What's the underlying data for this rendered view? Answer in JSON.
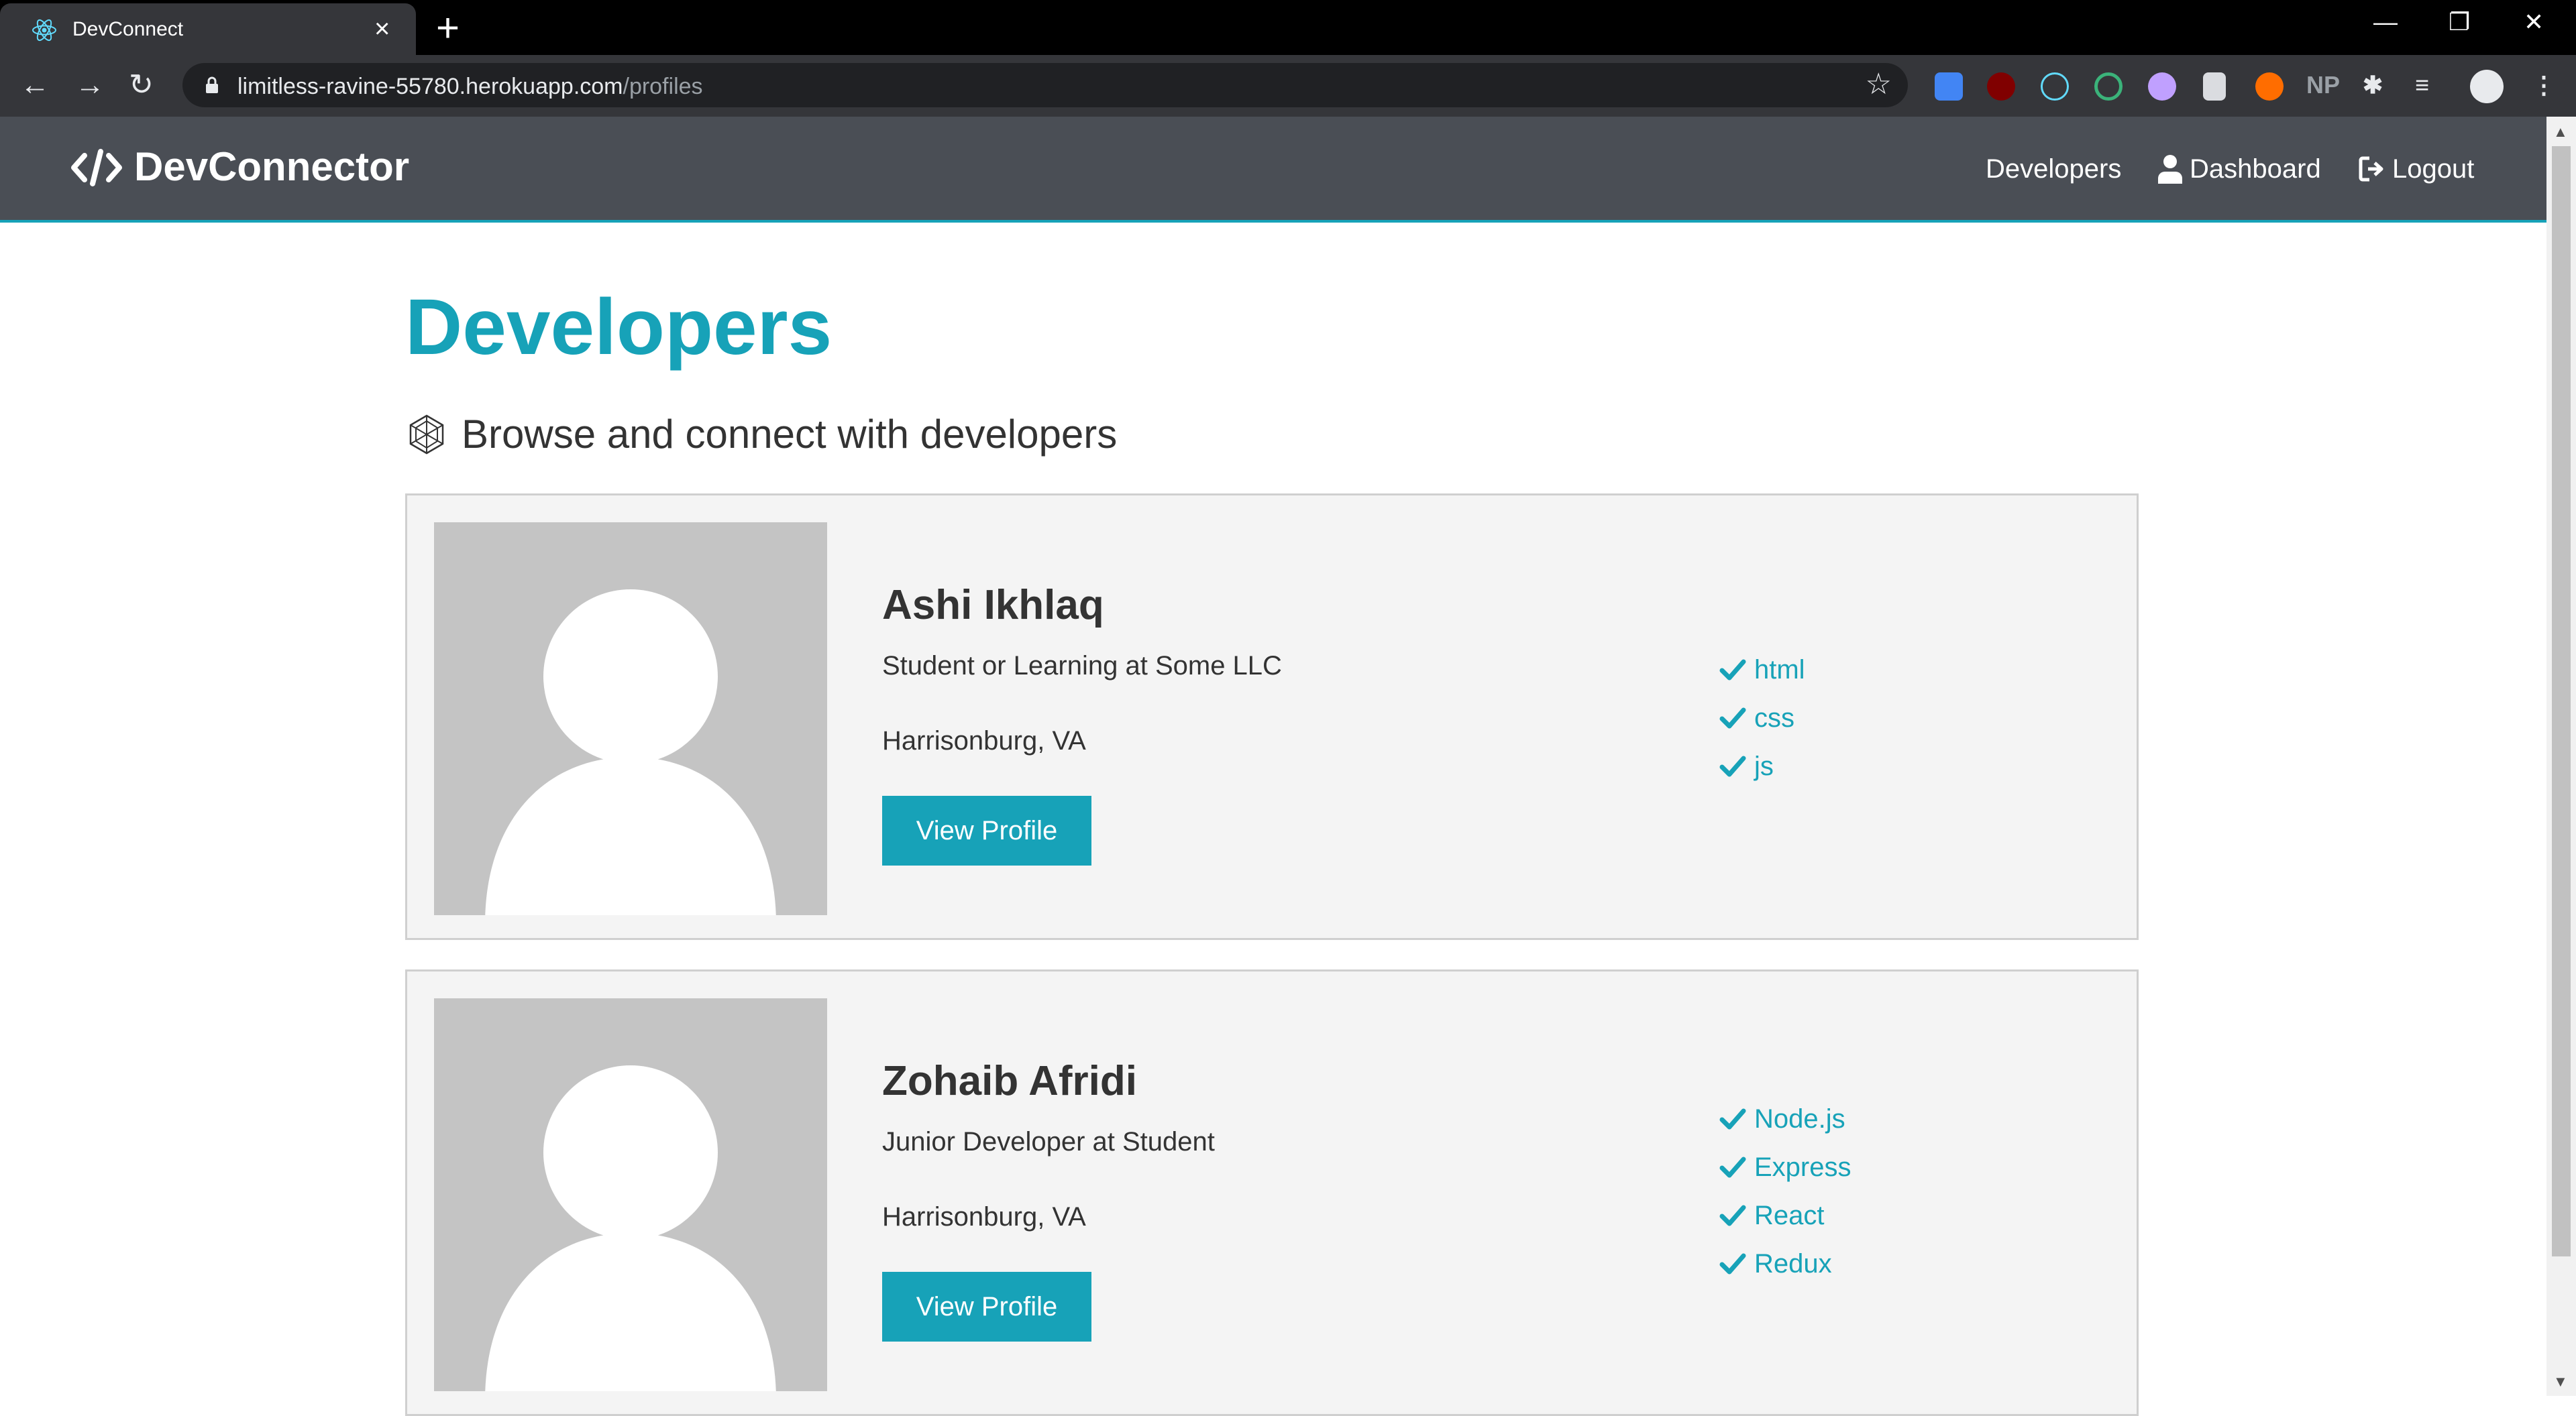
{
  "browser": {
    "tab_title": "DevConnect",
    "url_host": "limitless-ravine-55780.herokuapp.com",
    "url_path": "/profiles",
    "extension_text": "NP"
  },
  "navbar": {
    "brand": "DevConnector",
    "links": [
      {
        "label": "Developers",
        "icon": "none"
      },
      {
        "label": "Dashboard",
        "icon": "user-icon"
      },
      {
        "label": "Logout",
        "icon": "sign-out-icon"
      }
    ]
  },
  "page": {
    "title": "Developers",
    "lead": "Browse and connect with developers"
  },
  "profiles": [
    {
      "name": "Ashi Ikhlaq",
      "status": "Student or Learning at Some LLC",
      "location": "Harrisonburg, VA",
      "button": "View Profile",
      "skills": [
        "html",
        "css",
        "js"
      ]
    },
    {
      "name": "Zohaib Afridi",
      "status": "Junior Developer at Student",
      "location": "Harrisonburg, VA",
      "button": "View Profile",
      "skills": [
        "Node.js",
        "Express",
        "React",
        "Redux"
      ]
    }
  ],
  "colors": {
    "primary": "#17a2b8",
    "navbar": "#4a4e55",
    "card": "#f4f4f4"
  }
}
